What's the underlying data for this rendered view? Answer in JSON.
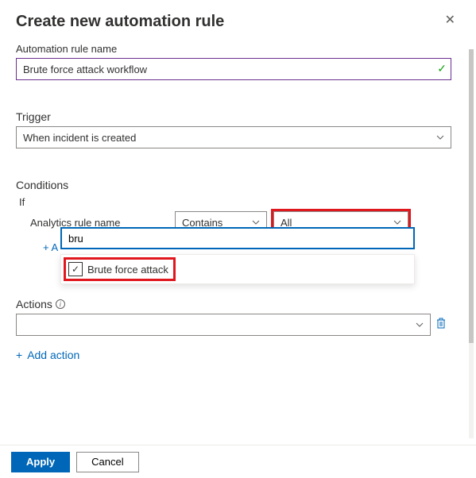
{
  "header": {
    "title": "Create new automation rule"
  },
  "ruleName": {
    "label": "Automation rule name",
    "value": "Brute force attack workflow"
  },
  "trigger": {
    "label": "Trigger",
    "selected": "When incident is created"
  },
  "conditions": {
    "label": "Conditions",
    "if": "If",
    "ruleNameLabel": "Analytics rule name",
    "operator": "Contains",
    "scope": "All",
    "searchValue": "bru",
    "addLink": "+ A",
    "suggestion": "Brute force attack"
  },
  "actions": {
    "label": "Actions",
    "selected": "",
    "addAction": "Add action"
  },
  "footer": {
    "apply": "Apply",
    "cancel": "Cancel"
  }
}
